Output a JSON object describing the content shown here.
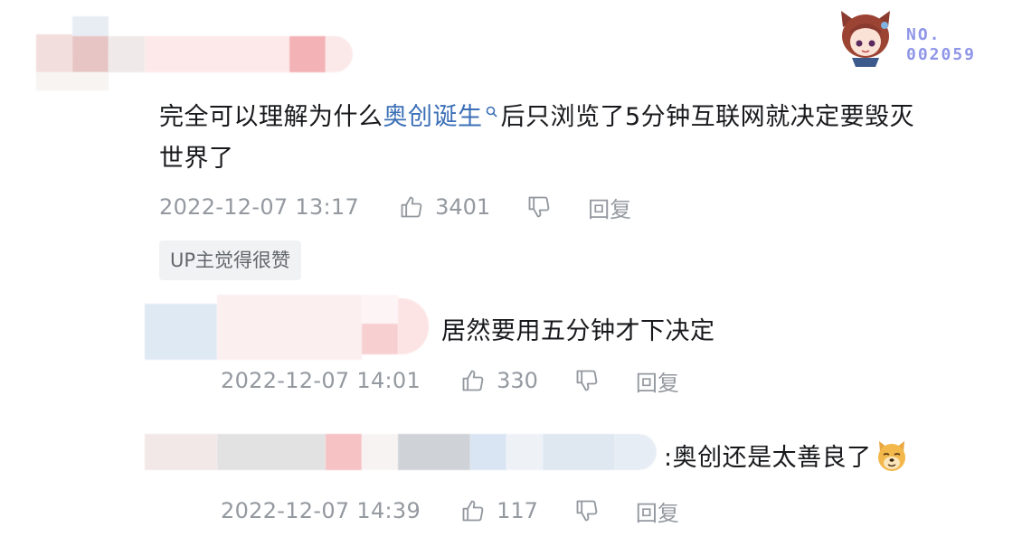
{
  "badge": {
    "label": "NO.",
    "number": "002059"
  },
  "comments": [
    {
      "text_before": "完全可以理解为什么",
      "link_text": "奥创诞生",
      "text_after_line1": "后只浏览了5分钟互联网就决定要毁灭",
      "text_line2": "世界了",
      "time": "2022-12-07 13:17",
      "likes": "3401",
      "reply_label": "回复",
      "up_tag": "UP主觉得很赞"
    }
  ],
  "replies": [
    {
      "text": "居然要用五分钟才下决定",
      "time": "2022-12-07 14:01",
      "likes": "330",
      "reply_label": "回复"
    },
    {
      "text": ":奥创还是太善良了",
      "emoji": "doge-icon",
      "time": "2022-12-07 14:39",
      "likes": "117",
      "reply_label": "回复"
    }
  ],
  "colors": {
    "link": "#3b6fb6",
    "meta": "#9499a0",
    "tag_bg": "#f1f2f3",
    "badge": "#8f96e8"
  }
}
